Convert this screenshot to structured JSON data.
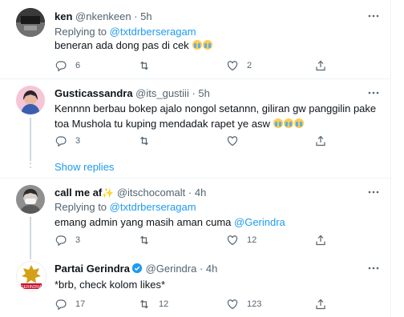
{
  "tweets": [
    {
      "name": "ken",
      "handle": "@nkenkeen",
      "time": "· 5h",
      "replying_prefix": "Replying to",
      "replying_to": "@txtdrberseragam",
      "text": "beneran ada dong pas di cek",
      "emoji_count": 2,
      "replies": "6",
      "retweets": "",
      "likes": "2"
    },
    {
      "name": "Gusticassandra",
      "handle": "@its_gustiii",
      "time": "· 5h",
      "text": "Kennnn berbau bokep ajalo nongol setannn, giliran gw panggilin pake toa Mushola tu kuping mendadak rapet ye asw",
      "emoji_count": 3,
      "replies": "3",
      "retweets": "",
      "likes": ""
    },
    {
      "name": "call me af",
      "name_emoji": "✨",
      "handle": "@itschocomalt",
      "time": "· 4h",
      "replying_prefix": "Replying to",
      "replying_to": "@txtdrberseragam",
      "text": "emang admin yang masih aman cuma",
      "mention": "@Gerindra",
      "replies": "3",
      "retweets": "",
      "likes": "12"
    },
    {
      "name": "Partai Gerindra",
      "handle": "@Gerindra",
      "time": "· 4h",
      "text": "*brb, check kolom likes*",
      "replies": "17",
      "retweets": "12",
      "likes": "123"
    }
  ],
  "show_replies": "Show replies",
  "logo_text": "GERINDRA",
  "icons": [
    "more-icon",
    "reply-icon",
    "retweet-icon",
    "like-icon",
    "share-icon",
    "verified-icon",
    "loudly-crying-face-emoji",
    "sparkles-emoji"
  ],
  "colors": {
    "accent": "#1d9bf0",
    "secondary_text": "#536471",
    "divider": "#eff3f4"
  }
}
